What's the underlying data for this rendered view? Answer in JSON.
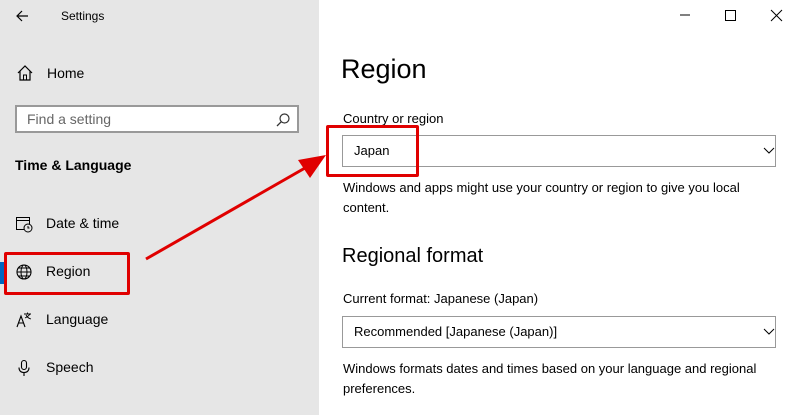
{
  "window": {
    "title": "Settings",
    "controls": [
      "minimize-icon",
      "maximize-icon",
      "close-icon"
    ]
  },
  "sidebar": {
    "home_label": "Home",
    "search_placeholder": "Find a setting",
    "section_title": "Time & Language",
    "items": [
      {
        "label": "Date & time",
        "icon": "clock-calendar-icon"
      },
      {
        "label": "Region",
        "icon": "globe-icon",
        "selected": true
      },
      {
        "label": "Language",
        "icon": "language-icon"
      },
      {
        "label": "Speech",
        "icon": "microphone-icon"
      }
    ]
  },
  "main": {
    "title": "Region",
    "country_label": "Country or region",
    "country_value": "Japan",
    "country_desc": "Windows and apps might use your country or region to give you local content.",
    "regional_format_title": "Regional format",
    "current_format_label": "Current format: Japanese (Japan)",
    "format_value": "Recommended [Japanese (Japan)]",
    "format_desc": "Windows formats dates and times based on your language and regional preferences."
  },
  "annotation": {
    "color": "#e00000"
  }
}
